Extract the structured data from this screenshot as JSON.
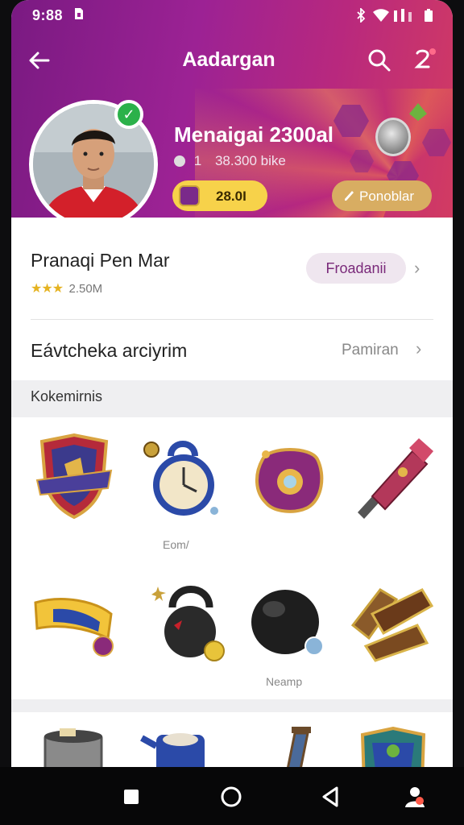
{
  "status_bar": {
    "time": "9:88"
  },
  "app_bar": {
    "title": "Aadargan"
  },
  "profile": {
    "name": "Menaigai 2300al",
    "stat_prefix": "1",
    "stat_text": "38.300 bike",
    "coins": "28.0I",
    "edit_label": "Ponoblar"
  },
  "card": {
    "row1_title": "Pranaqi Pen Mar",
    "rating_stars": 3,
    "rating_text": "2.50M",
    "level_label": "Froadanii",
    "row2_label": "Eávtcheka arciyrim",
    "row2_value": "Pamiran"
  },
  "section": {
    "title": "Kokemirnis"
  },
  "items": {
    "clock_caption": "Eom/",
    "ball_caption": "Neamp"
  },
  "colors": {
    "header_start": "#7a1a82",
    "header_end": "#d23b62",
    "coin_pill": "#f7d24a",
    "edit_pill": "#d8ad62",
    "verified": "#2bb14a"
  }
}
